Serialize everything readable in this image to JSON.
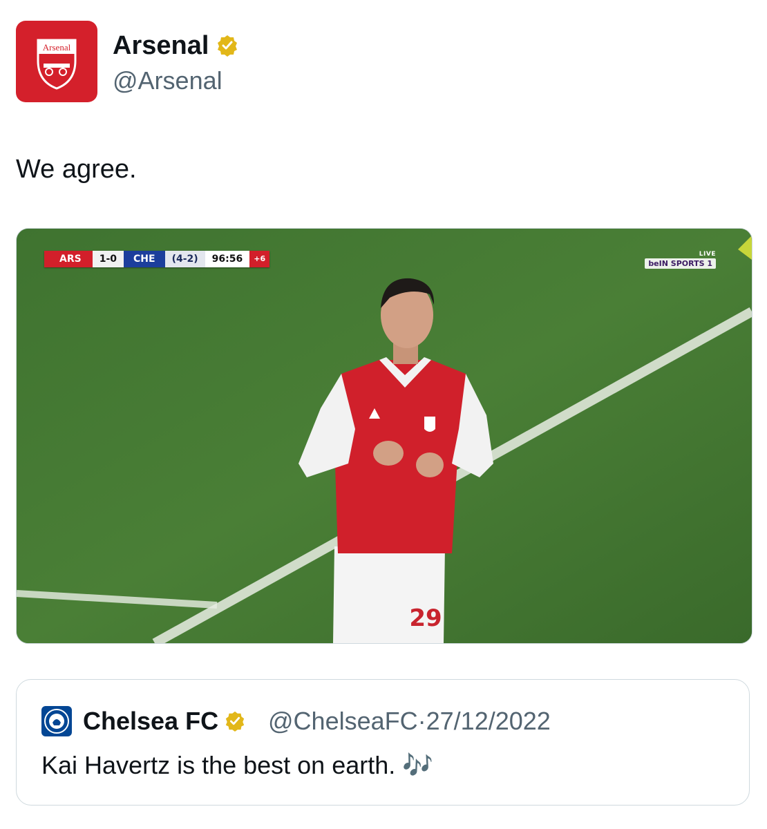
{
  "tweet": {
    "author_name": "Arsenal",
    "author_handle": "@Arsenal",
    "avatar_text": "Arsenal",
    "text": "We agree.",
    "verified_icon": "verified-badge-gold"
  },
  "media": {
    "scorebug": {
      "home": "ARS",
      "score": "1-0",
      "away": "CHE",
      "aggregate": "(4-2)",
      "clock": "96:56",
      "added_time": "+6"
    },
    "broadcaster": {
      "live": "LIVE",
      "channel": "beIN SPORTS 1"
    },
    "shirt_number": "29"
  },
  "quoted_tweet": {
    "author_name": "Chelsea FC",
    "author_handle": "@ChelseaFC",
    "separator": "·",
    "date": "27/12/2022",
    "text": "Kai Havertz is the best on earth.",
    "emoji": "🎶",
    "verified_icon": "verified-badge-gold"
  },
  "colors": {
    "arsenal_red": "#d4202b",
    "chelsea_blue": "#034694",
    "verified_gold": "#e2b719",
    "handle_gray": "#536471"
  }
}
